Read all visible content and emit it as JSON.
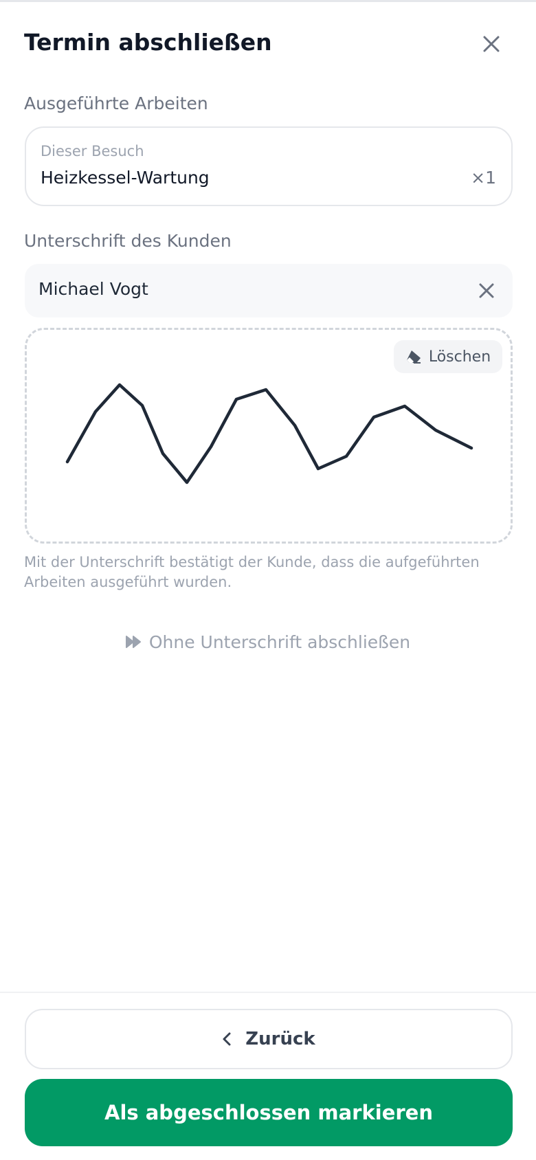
{
  "header": {
    "title": "Termin abschließen"
  },
  "work": {
    "section_label": "Ausgeführte Arbeiten",
    "item": {
      "subtitle": "Dieser Besuch",
      "name": "Heizkessel-Wartung",
      "quantity": "×1"
    }
  },
  "signature": {
    "section_label": "Unterschrift des Kunden",
    "signer_name": "Michael Vogt",
    "clear_label": "Löschen",
    "hint": "Mit der Unterschrift bestätigt der Kunde, dass die aufgeführten Arbeiten ausgeführt wurden."
  },
  "skip": {
    "label": "Ohne Unterschrift abschließen",
    "icon": "fast-forward-icon"
  },
  "footer": {
    "back_label": "Zurück",
    "complete_label": "Als abgeschlossen markieren"
  },
  "colors": {
    "primary": "#029a65",
    "stroke": "#1f2937"
  }
}
